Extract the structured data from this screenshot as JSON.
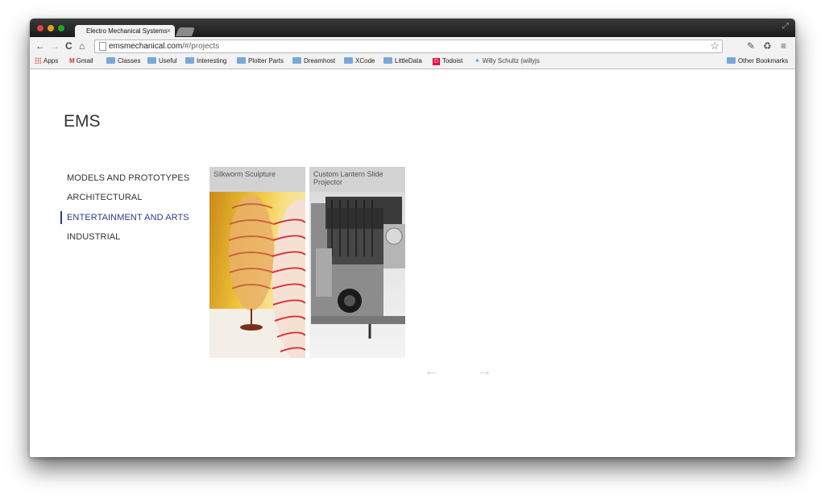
{
  "browser": {
    "tab_title": "Electro Mechanical Systems",
    "tab_close": "×",
    "url_host": "emsmechanical.com",
    "url_path": "/#/projects",
    "nav": {
      "back": "←",
      "forward": "→",
      "reload": "C",
      "home": "⌂"
    },
    "star": "☆",
    "menu": "≡",
    "bookmarks": [
      {
        "label": "Apps",
        "icon": "apps-grid-icon"
      },
      {
        "label": "Gmail",
        "icon": "gmail-icon"
      },
      {
        "label": "Classes",
        "icon": "folder-icon"
      },
      {
        "label": "Useful",
        "icon": "folder-icon"
      },
      {
        "label": "Interesting",
        "icon": "folder-icon"
      },
      {
        "label": "Plotter Parts",
        "icon": "folder-icon"
      },
      {
        "label": "Dreamhost",
        "icon": "folder-icon"
      },
      {
        "label": "XCode",
        "icon": "folder-icon"
      },
      {
        "label": "LittleData",
        "icon": "folder-icon"
      },
      {
        "label": "Todoist",
        "icon": "todoist-icon"
      },
      {
        "label": "Willy Schultz (willyjs",
        "icon": "twitter-icon"
      }
    ],
    "other_bookmarks": "Other Bookmarks"
  },
  "site": {
    "title": "EMS",
    "categories": [
      {
        "label": "MODELS AND PROTOTYPES",
        "active": false
      },
      {
        "label": "ARCHITECTURAL",
        "active": false
      },
      {
        "label": "ENTERTAINMENT AND ARTS",
        "active": true
      },
      {
        "label": "INDUSTRIAL",
        "active": false
      }
    ],
    "projects": [
      {
        "title": "Silkworm Sculpture"
      },
      {
        "title": "Custom Lantern Slide Projector"
      }
    ],
    "prev_arrow": "←",
    "next_arrow": "→",
    "colors": {
      "active_category": "#2b3d8f",
      "arrow_disabled": "#d4d4d4"
    }
  }
}
